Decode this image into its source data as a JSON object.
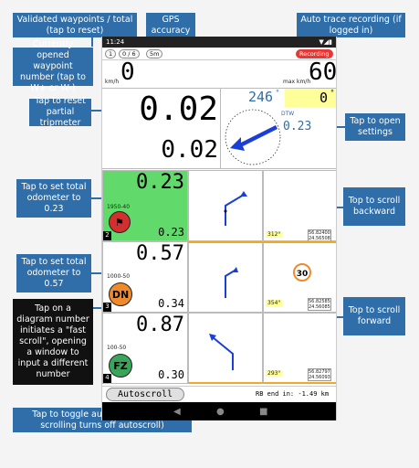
{
  "callouts": {
    "validated": "Validated waypoints / total (tap to reset)",
    "gps": "GPS accuracy",
    "autotrace": "Auto trace recording (if logged in)",
    "current_wp": "Currently opened waypoint number (tap to W+ or W-)",
    "reset_partial": "Tap to reset partial tripmeter",
    "open_settings": "Tap to open settings",
    "set_odo_023": "Tap to set total odometer to 0.23",
    "scroll_back": "Top to scroll backward",
    "set_odo_057": "Tap to set total odometer to 0.57",
    "scroll_fwd": "Top to scroll forward",
    "fast_scroll": "Tap on a diagram number initiates a \"fast scroll\", opening a window to input a different number",
    "autoscroll_toggle": "Tap to toggle autoscroll (manual scrolling turns off autoscroll)"
  },
  "status": {
    "time": "11:24",
    "icons": "▼◢▮"
  },
  "header": {
    "chip1": "1",
    "chip2": "0 / 6",
    "chip3": "5m",
    "recording": "Recording"
  },
  "speed": {
    "current": "0",
    "unit": "km/h",
    "max": "60",
    "max_unit": "max km/h"
  },
  "trip": {
    "partial": "0.02",
    "total": "0.02"
  },
  "compass": {
    "heading": "246",
    "heading_unit": "°",
    "cap": "0",
    "cap_unit": "°",
    "dtw_label": "DTW",
    "dtw": "0.23"
  },
  "rows": [
    {
      "odo": "0.23",
      "dist": "1950-40",
      "partial": "0.23",
      "num": "2",
      "badge": "",
      "badge_color": "#d32f2f",
      "note": "312°",
      "coords": "56.82400\n24.56508"
    },
    {
      "odo": "0.57",
      "dist": "1000-50",
      "partial": "0.34",
      "num": "3",
      "badge": "DN",
      "badge_color": "#ef8a2a",
      "note": "354°",
      "coords": "56.82585\n24.56085",
      "limit": "30"
    },
    {
      "odo": "0.87",
      "dist": "100-50",
      "partial": "0.30",
      "num": "4",
      "badge": "FZ",
      "badge_color": "#3aa55a",
      "note": "293°",
      "coords": "56.82797\n24.56093"
    }
  ],
  "footer": {
    "autoscroll": "Autoscroll",
    "rb_end": "RB end in: -1.49 km"
  },
  "colors": {
    "accent": "#2f6ea8",
    "green_cell": "#62d96b",
    "yellow": "#ffff99",
    "compass_arrow": "#1a3fd9",
    "orange_frame": "#f5a623"
  }
}
